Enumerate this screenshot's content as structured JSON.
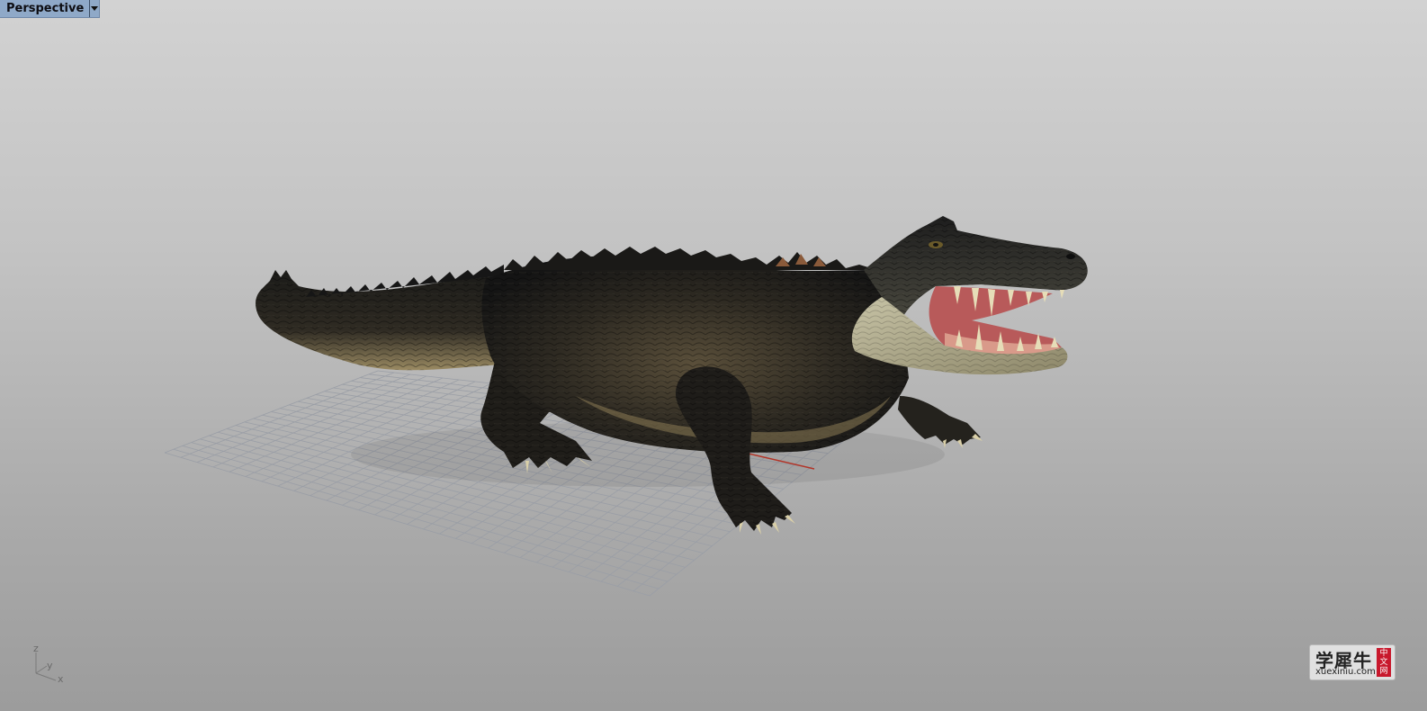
{
  "viewport": {
    "title": "Perspective",
    "background_top": "#d2d2d2",
    "background_bottom": "#9c9c9c"
  },
  "scene": {
    "model": "crocodile",
    "grid_color": "#9a9ea6",
    "x_axis_color": "#c0392b",
    "y_axis_color": "#27ae60"
  },
  "axis_indicator": {
    "z": "z",
    "y": "y",
    "x": "x"
  },
  "watermark": {
    "brand_cn": "学犀牛",
    "domain": "xuexiniu.com",
    "badge": [
      "中",
      "文",
      "网"
    ],
    "badge_color": "#c8182c"
  }
}
